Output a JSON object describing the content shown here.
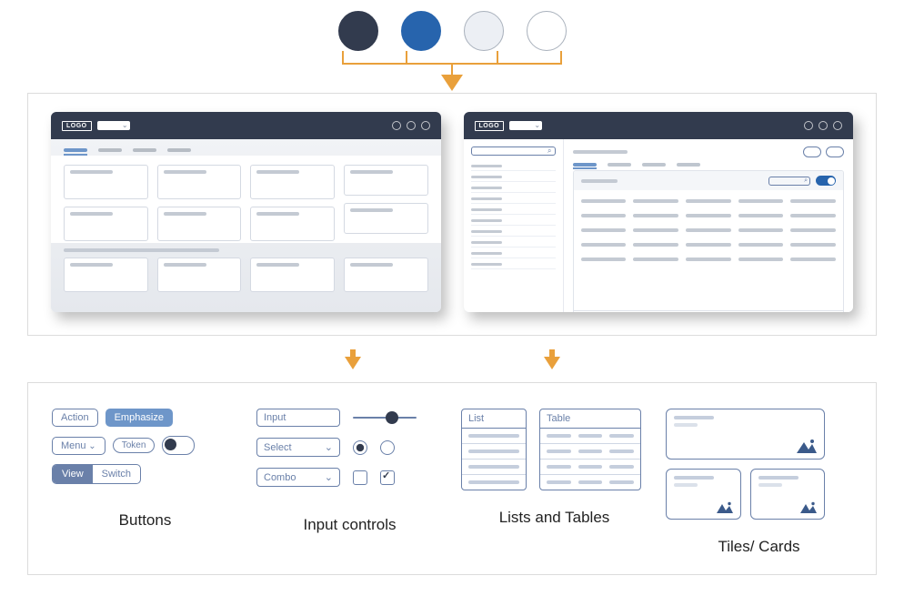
{
  "palette": {
    "navy": "#323B4E",
    "blue": "#2764AD",
    "light": "#ECEFF4",
    "white": "#FFFFFF"
  },
  "mock": {
    "logo_label": "LOGO"
  },
  "buttons": {
    "action": "Action",
    "emphasize": "Emphasize",
    "menu": "Menu",
    "token": "Token",
    "view": "View",
    "switch": "Switch"
  },
  "inputs": {
    "input": "Input",
    "select": "Select",
    "combo": "Combo"
  },
  "lists": {
    "list": "List",
    "table": "Table"
  },
  "sections": {
    "buttons": "Buttons",
    "inputs": "Input controls",
    "lists": "Lists and Tables",
    "tiles": "Tiles/ Cards"
  }
}
